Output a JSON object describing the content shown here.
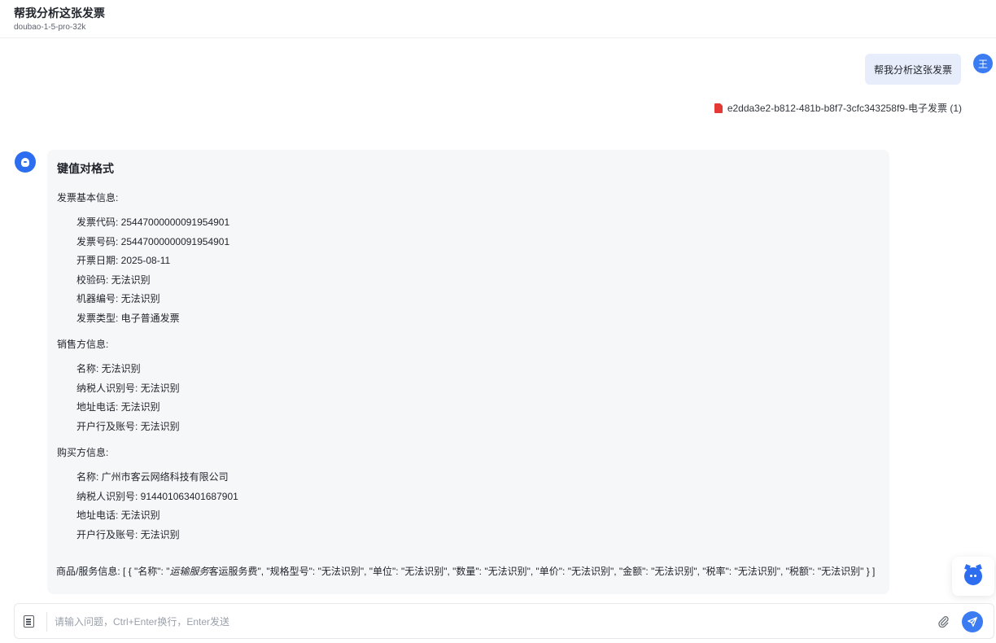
{
  "header": {
    "title": "帮我分析这张发票",
    "model": "doubao-1-5-pro-32k"
  },
  "user": {
    "avatar_initial": "王",
    "message": "帮我分析这张发票",
    "attachment_name": "e2dda3e2-b812-481b-b8f7-3cfc343258f9-电子发票 (1)"
  },
  "answer": {
    "heading": "键值对格式",
    "sections": [
      {
        "title": "发票基本信息:",
        "items": [
          "发票代码: 25447000000091954901",
          "发票号码: 25447000000091954901",
          "开票日期: 2025-08-11",
          "校验码: 无法识别",
          "机器编号: 无法识别",
          "发票类型: 电子普通发票"
        ]
      },
      {
        "title": "销售方信息:",
        "items": [
          "名称: 无法识别",
          "纳税人识别号: 无法识别",
          "地址电话: 无法识别",
          "开户行及账号: 无法识别"
        ]
      },
      {
        "title": "购买方信息:",
        "items": [
          "名称: 广州市客云网络科技有限公司",
          "纳税人识别号: 914401063401687901",
          "地址电话: 无法识别",
          "开户行及账号: 无法识别"
        ]
      }
    ],
    "goods_prefix": "商品/服务信息: [ { \"名称\": \"",
    "goods_italic": "运输服务",
    "goods_suffix": "客运服务费\", \"规格型号\": \"无法识别\", \"单位\": \"无法识别\", \"数量\": \"无法识别\", \"单价\": \"无法识别\", \"金额\": \"无法识别\", \"税率\": \"无法识别\", \"税额\": \"无法识别\" } ]"
  },
  "composer": {
    "placeholder": "请输入问题，Ctrl+Enter换行，Enter发送",
    "value": ""
  },
  "colors": {
    "accent": "#3b7cf3",
    "user_bubble": "#e8edfb",
    "answer_bg": "#f6f7f9"
  },
  "icons": {
    "attachment_file": "pdf-file-icon",
    "bot": "bot-avatar-icon",
    "composer_left": "document-icon",
    "attach": "paperclip-icon",
    "send": "send-icon",
    "float_assistant": "assistant-robot-icon"
  }
}
